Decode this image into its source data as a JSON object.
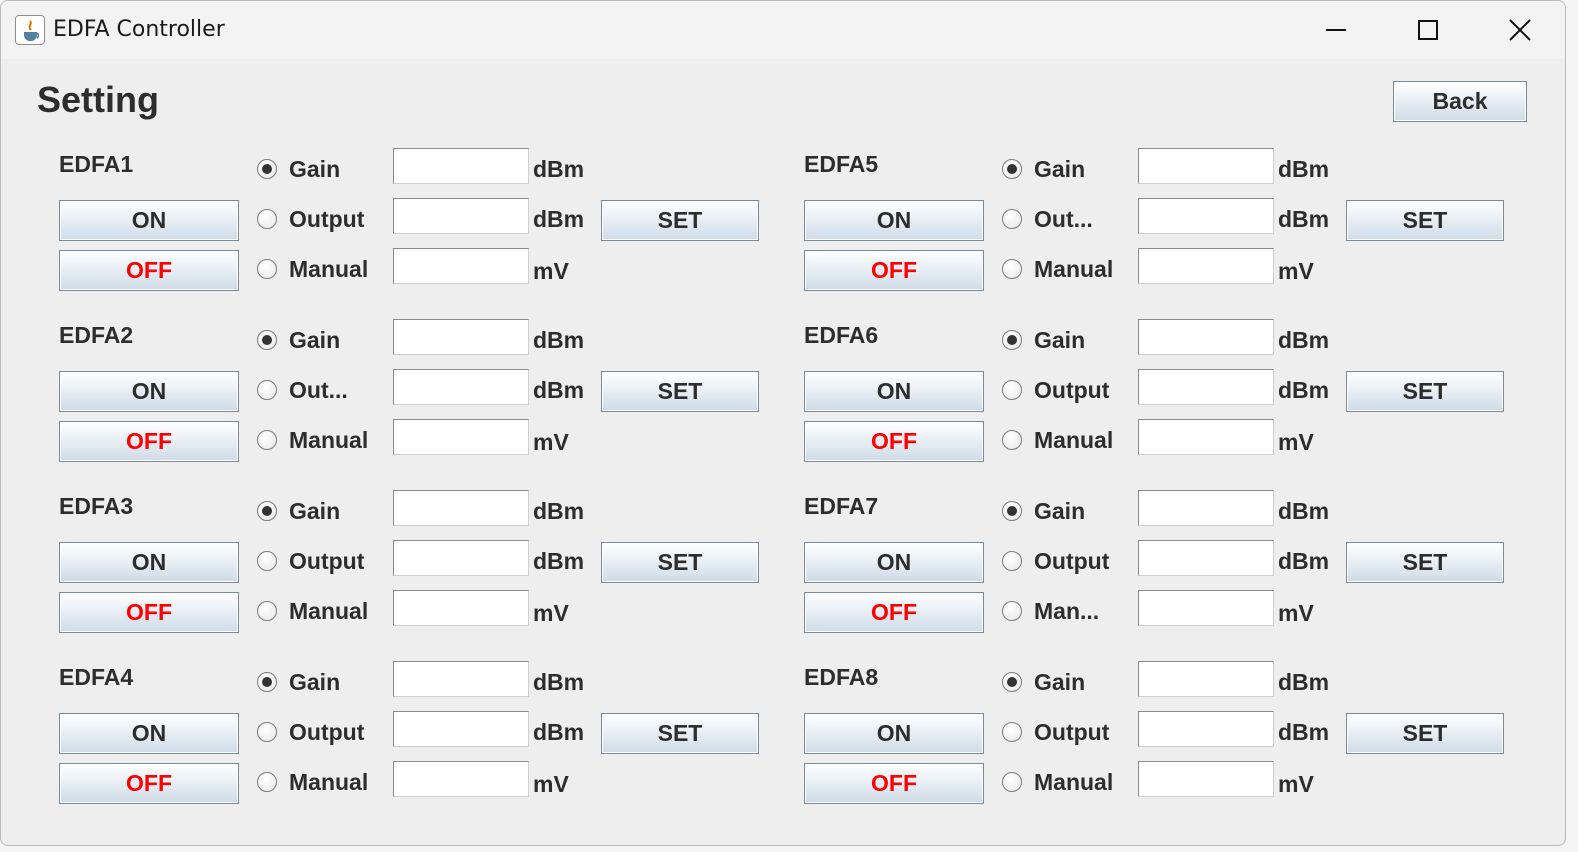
{
  "window": {
    "title": "EDFA Controller",
    "icon": "java-cup-icon"
  },
  "heading": "Setting",
  "back_label": "Back",
  "panels": [
    {
      "name": "EDFA1",
      "on": "ON",
      "off": "OFF",
      "set": "SET",
      "gain": "Gain",
      "output": "Output",
      "manual": "Manual",
      "unit_gain": "dBm",
      "unit_output": "dBm",
      "unit_manual": "mV",
      "selected": "gain",
      "gain_value": "",
      "output_value": "",
      "manual_value": ""
    },
    {
      "name": "EDFA2",
      "on": "ON",
      "off": "OFF",
      "set": "SET",
      "gain": "Gain",
      "output": "Out...",
      "manual": "Manual",
      "unit_gain": "dBm",
      "unit_output": "dBm",
      "unit_manual": "mV",
      "selected": "gain",
      "gain_value": "",
      "output_value": "",
      "manual_value": ""
    },
    {
      "name": "EDFA3",
      "on": "ON",
      "off": "OFF",
      "set": "SET",
      "gain": "Gain",
      "output": "Output",
      "manual": "Manual",
      "unit_gain": "dBm",
      "unit_output": "dBm",
      "unit_manual": "mV",
      "selected": "gain",
      "gain_value": "",
      "output_value": "",
      "manual_value": ""
    },
    {
      "name": "EDFA4",
      "on": "ON",
      "off": "OFF",
      "set": "SET",
      "gain": "Gain",
      "output": "Output",
      "manual": "Manual",
      "unit_gain": "dBm",
      "unit_output": "dBm",
      "unit_manual": "mV",
      "selected": "gain",
      "gain_value": "",
      "output_value": "",
      "manual_value": ""
    },
    {
      "name": "EDFA5",
      "on": "ON",
      "off": "OFF",
      "set": "SET",
      "gain": "Gain",
      "output": "Out...",
      "manual": "Manual",
      "unit_gain": "dBm",
      "unit_output": "dBm",
      "unit_manual": "mV",
      "selected": "gain",
      "gain_value": "",
      "output_value": "",
      "manual_value": ""
    },
    {
      "name": "EDFA6",
      "on": "ON",
      "off": "OFF",
      "set": "SET",
      "gain": "Gain",
      "output": "Output",
      "manual": "Manual",
      "unit_gain": "dBm",
      "unit_output": "dBm",
      "unit_manual": "mV",
      "selected": "gain",
      "gain_value": "",
      "output_value": "",
      "manual_value": ""
    },
    {
      "name": "EDFA7",
      "on": "ON",
      "off": "OFF",
      "set": "SET",
      "gain": "Gain",
      "output": "Output",
      "manual": "Man...",
      "unit_gain": "dBm",
      "unit_output": "dBm",
      "unit_manual": "mV",
      "selected": "gain",
      "gain_value": "",
      "output_value": "",
      "manual_value": ""
    },
    {
      "name": "EDFA8",
      "on": "ON",
      "off": "OFF",
      "set": "SET",
      "gain": "Gain",
      "output": "Output",
      "manual": "Manual",
      "unit_gain": "dBm",
      "unit_output": "dBm",
      "unit_manual": "mV",
      "selected": "gain",
      "gain_value": "",
      "output_value": "",
      "manual_value": ""
    }
  ],
  "colors": {
    "off_text": "#ff0000",
    "window_bg": "#eeeeee",
    "text": "#2d2d2d"
  }
}
